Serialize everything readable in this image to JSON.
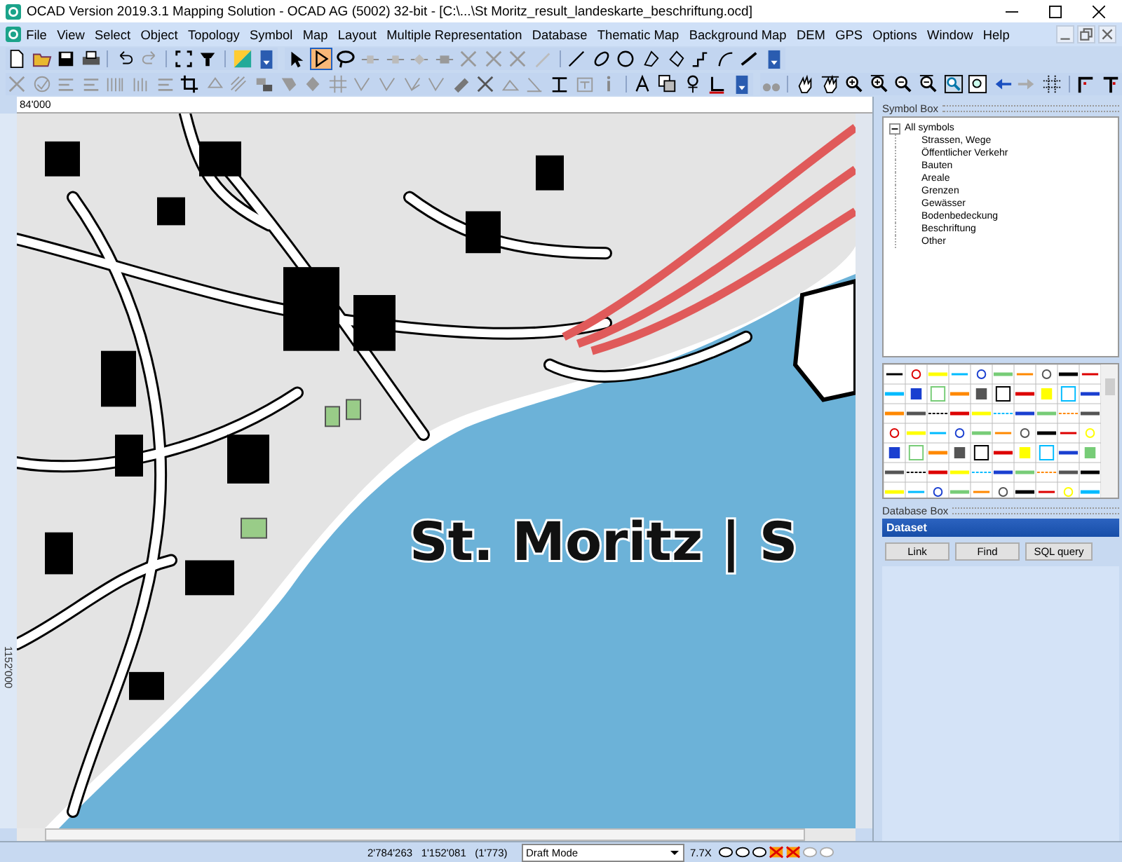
{
  "window": {
    "title": "OCAD Version 2019.3.1  Mapping Solution - OCAD AG (5002) 32-bit - [C:\\...\\St Moritz_result_landeskarte_beschriftung.ocd]"
  },
  "menu": [
    "File",
    "View",
    "Select",
    "Object",
    "Topology",
    "Symbol",
    "Map",
    "Layout",
    "Multiple Representation",
    "Database",
    "Thematic Map",
    "Background Map",
    "DEM",
    "GPS",
    "Options",
    "Window",
    "Help"
  ],
  "tools": [
    {
      "kind": "pointer",
      "selected": false
    },
    {
      "kind": "edit-point",
      "selected": true
    },
    {
      "kind": "lasso",
      "selected": false
    }
  ],
  "rulers": {
    "horizontal": "84'000",
    "vertical": "1152'000"
  },
  "map": {
    "label": "St. Moritz | S"
  },
  "symbol_box": {
    "title": "Symbol Box",
    "tree": [
      {
        "label": "All symbols",
        "expanded": true,
        "children": [
          {
            "label": "Strassen, Wege"
          },
          {
            "label": "Öffentlicher Verkehr"
          },
          {
            "label": "Bauten"
          },
          {
            "label": "Areale"
          },
          {
            "label": "Grenzen"
          },
          {
            "label": "Gewässer"
          },
          {
            "label": "Bodenbedeckung"
          },
          {
            "label": "Beschriftung"
          },
          {
            "label": "Other"
          }
        ]
      }
    ]
  },
  "database_box": {
    "title": "Database Box",
    "dataset": "Dataset",
    "buttons": [
      "Link",
      "Find",
      "SQL query"
    ]
  },
  "status_bar": {
    "coordinates": "2'784'263   1'152'081   (1'773)",
    "mode": "Draft Mode",
    "zoom": "7.7X"
  }
}
